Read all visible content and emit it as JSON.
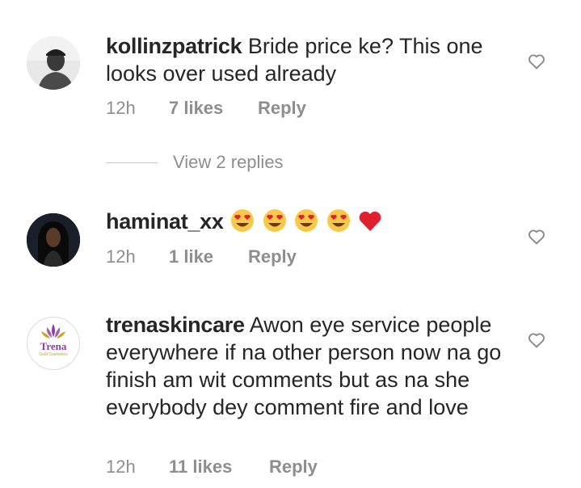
{
  "comments": [
    {
      "username": "kollinzpatrick",
      "text": "Bride price ke? This one looks over used already",
      "time": "12h",
      "likes": "7 likes",
      "reply": "Reply"
    },
    {
      "username": "haminat_xx",
      "text": "",
      "emoji": [
        "smiling-face-with-heart-eyes",
        "smiling-face-with-heart-eyes",
        "smiling-face-with-heart-eyes",
        "smiling-face-with-heart-eyes",
        "red-heart"
      ],
      "time": "12h",
      "likes": "1 like",
      "reply": "Reply"
    },
    {
      "username": "trenaskincare",
      "text": "Awon eye service people everywhere if na other person now  na go finish am wit comments but as na she everybody dey comment fire and love",
      "time": "12h",
      "likes": "11 likes",
      "reply": "Reply",
      "avatar_logo_text": "Trena",
      "avatar_logo_subtext": "Gold Cosmetics"
    }
  ],
  "view_replies": "View 2 replies",
  "colors": {
    "text": "#262626",
    "secondary": "#8e8e8e",
    "heart_icon": "#8e8e8e",
    "emoji_face": "#f7c948",
    "emoji_heart": "#e02030",
    "logo_purple": "#8a3fa0",
    "logo_gold": "#c9a227"
  }
}
